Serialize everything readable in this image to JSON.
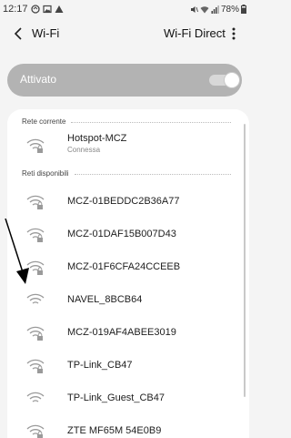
{
  "status_bar": {
    "time": "12:17",
    "battery": "78%",
    "icons_left": [
      "sync-icon",
      "image-icon",
      "warning-icon"
    ],
    "icons_right": [
      "mute-icon",
      "wifi-icon",
      "signal-icon",
      "battery-icon"
    ]
  },
  "header": {
    "title": "Wi-Fi",
    "wifi_direct_label": "Wi-Fi Direct"
  },
  "toggle": {
    "label": "Attivato",
    "state": "on"
  },
  "current_network": {
    "section_label": "Rete corrente",
    "name": "Hotspot-MCZ",
    "status": "Connessa"
  },
  "available": {
    "section_label": "Reti disponibili",
    "networks": [
      {
        "name": "MCZ-01BEDDC2B36A77",
        "locked": true
      },
      {
        "name": "MCZ-01DAF15B007D43",
        "locked": true
      },
      {
        "name": "MCZ-01F6CFA24CCEEB",
        "locked": true
      },
      {
        "name": "NAVEL_8BCB64",
        "locked": false
      },
      {
        "name": "MCZ-019AF4ABEE3019",
        "locked": true
      },
      {
        "name": "TP-Link_CB47",
        "locked": true
      },
      {
        "name": "TP-Link_Guest_CB47",
        "locked": false
      },
      {
        "name": "ZTE MF65M 54E0B9",
        "locked": true
      }
    ]
  },
  "colors": {
    "background": "#f4f4f4",
    "toggle_card": "#b3b3b3",
    "card": "#ffffff",
    "icon": "#9a9a9a"
  }
}
